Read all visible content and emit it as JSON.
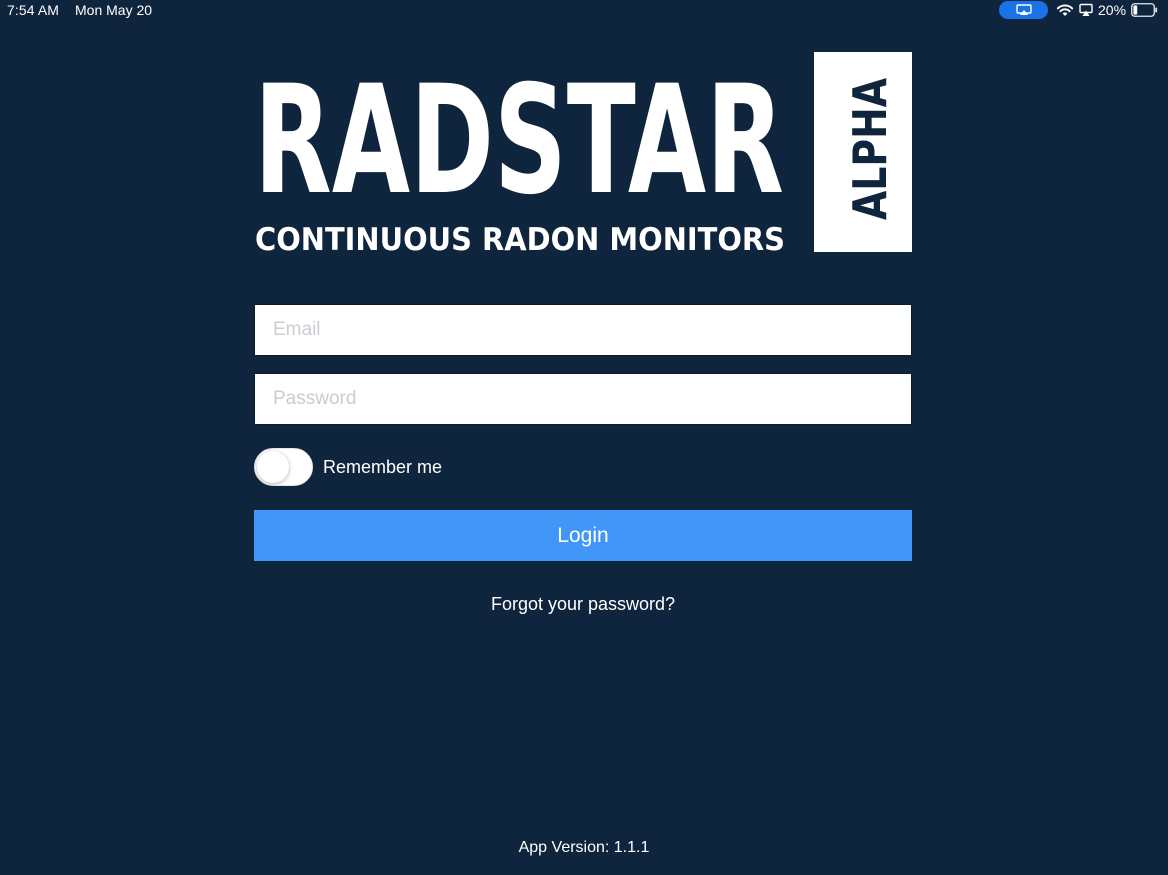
{
  "status_bar": {
    "time": "7:54 AM",
    "date": "Mon May 20",
    "battery_percent": "20%",
    "battery_level": 0.2,
    "icons": [
      "airplay-icon",
      "wifi-icon",
      "screen-mirroring-icon",
      "battery-icon"
    ],
    "airplay_pill_color": "#1a72e8"
  },
  "logo": {
    "title": "RADSTAR",
    "subtitle": "CONTINUOUS RADON MONITORS",
    "badge": "ALPHA"
  },
  "login_form": {
    "email_placeholder": "Email",
    "email_value": "",
    "password_placeholder": "Password",
    "password_value": "",
    "remember_me_label": "Remember me",
    "remember_me_on": false,
    "login_label": "Login",
    "forgot_password_label": "Forgot your password?"
  },
  "footer": {
    "app_version": "App Version: 1.1.1"
  },
  "colors": {
    "background": "#0f253d",
    "accent": "#4196f8",
    "text": "#ffffff"
  }
}
